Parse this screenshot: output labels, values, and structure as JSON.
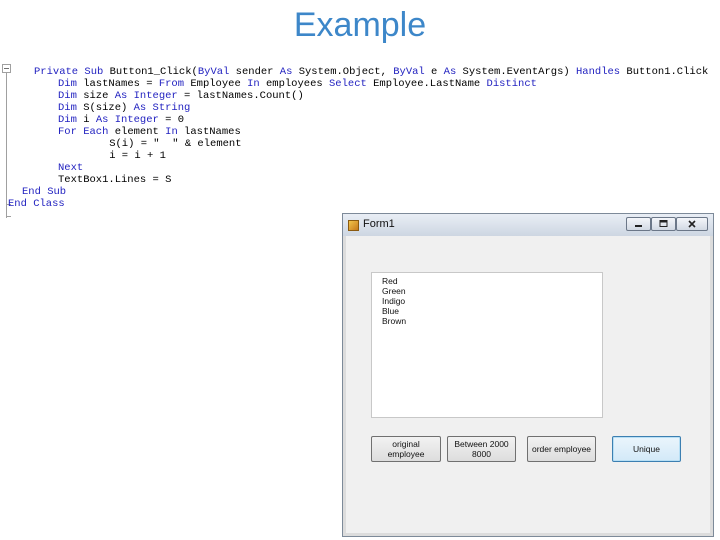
{
  "slide": {
    "title": "Example"
  },
  "code": {
    "lines": [
      [
        {
          "t": "Private Sub ",
          "k": 1
        },
        {
          "t": "Button1_Click(",
          "k": 0
        },
        {
          "t": "ByVal",
          "k": 1
        },
        {
          "t": " sender ",
          "k": 0
        },
        {
          "t": "As",
          "k": 1
        },
        {
          "t": " System.Object, ",
          "k": 0
        },
        {
          "t": "ByVal",
          "k": 1
        },
        {
          "t": " e ",
          "k": 0
        },
        {
          "t": "As",
          "k": 1
        },
        {
          "t": " System.EventArgs) ",
          "k": 0
        },
        {
          "t": "Handles",
          "k": 1
        },
        {
          "t": " Button1.Click",
          "k": 0
        }
      ],
      [
        {
          "t": "    Dim",
          "k": 1
        },
        {
          "t": " lastNames = ",
          "k": 0
        },
        {
          "t": "From",
          "k": 1
        },
        {
          "t": " Employee ",
          "k": 0
        },
        {
          "t": "In",
          "k": 1
        },
        {
          "t": " employees ",
          "k": 0
        },
        {
          "t": "Select",
          "k": 1
        },
        {
          "t": " Employee.LastName ",
          "k": 0
        },
        {
          "t": "Distinct",
          "k": 1
        }
      ],
      [
        {
          "t": "    Dim",
          "k": 1
        },
        {
          "t": " size ",
          "k": 0
        },
        {
          "t": "As Integer",
          "k": 1
        },
        {
          "t": " = lastNames.Count()",
          "k": 0
        }
      ],
      [
        {
          "t": "    Dim",
          "k": 1
        },
        {
          "t": " S(size) ",
          "k": 0
        },
        {
          "t": "As String",
          "k": 1
        }
      ],
      [
        {
          "t": "    Dim",
          "k": 1
        },
        {
          "t": " i ",
          "k": 0
        },
        {
          "t": "As Integer",
          "k": 1
        },
        {
          "t": " = 0",
          "k": 0
        }
      ],
      [
        {
          "t": "    For Each",
          "k": 1
        },
        {
          "t": " element ",
          "k": 0
        },
        {
          "t": "In",
          "k": 1
        },
        {
          "t": " lastNames",
          "k": 0
        }
      ],
      [
        {
          "t": "        S(i) = \"  \" & element",
          "k": 0
        }
      ],
      [
        {
          "t": "        i = i + 1",
          "k": 0
        }
      ],
      [
        {
          "t": "    Next",
          "k": 1
        }
      ],
      [
        {
          "t": "    TextBox1.Lines = S",
          "k": 0
        }
      ],
      [
        {
          "t": "End Sub",
          "k": 1
        }
      ],
      [
        {
          "t": "End Class",
          "k": 1
        }
      ]
    ]
  },
  "form": {
    "title": "Form1",
    "list_items": [
      "Red",
      "Green",
      "Indigo",
      "Blue",
      "Brown"
    ],
    "buttons": {
      "original": "original employee",
      "between": "Between 2000 8000",
      "order": "order employee",
      "unique": "Unique"
    }
  }
}
